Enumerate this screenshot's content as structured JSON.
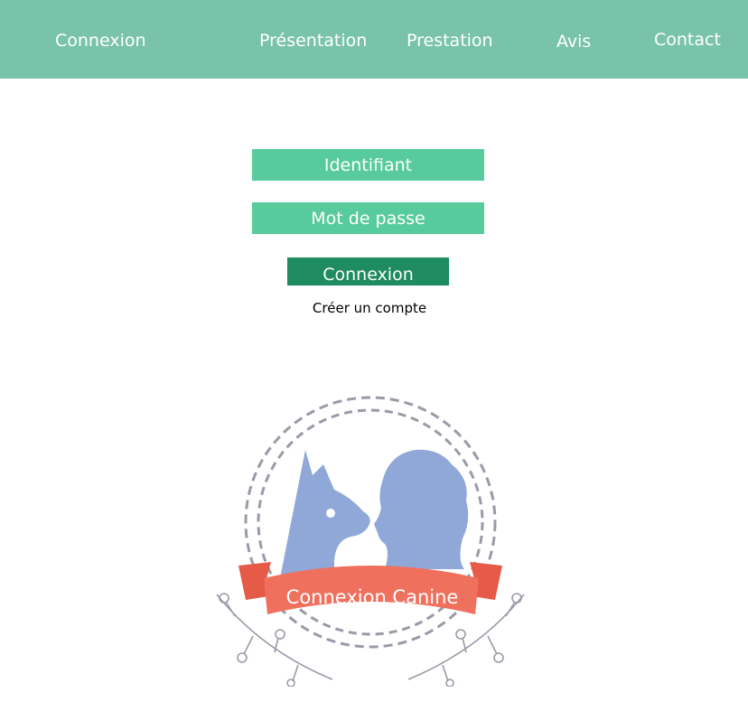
{
  "nav": {
    "items": [
      {
        "label": "Connexion"
      },
      {
        "label": "Présentation"
      },
      {
        "label": "Prestation"
      },
      {
        "label": "Avis"
      },
      {
        "label": "Contact"
      }
    ]
  },
  "form": {
    "username_placeholder": "Identifiant",
    "password_placeholder": "Mot de passe",
    "submit_label": "Connexion",
    "create_account_label": "Créer un compte"
  },
  "logo": {
    "banner_text": "Connexion Canine"
  },
  "colors": {
    "nav_bg": "#79c3ab",
    "field_bg": "#57cb9b",
    "button_bg": "#1e8b60",
    "silhouette": "#8fa8d8",
    "ribbon": "#f0705e",
    "frame": "#9a9aa8"
  }
}
